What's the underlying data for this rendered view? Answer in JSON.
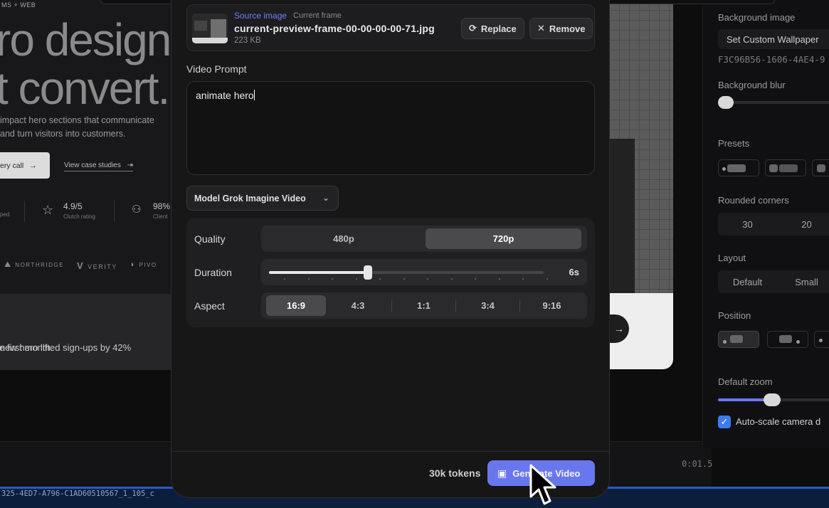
{
  "background_site": {
    "eyebrow": "MS + WEB",
    "hero_line1": "ro designs",
    "hero_line2": "t convert.",
    "sub_line1": "impact hero sections that communicate",
    "sub_line2": "and turn visitors into customers.",
    "cta_label": "ery call",
    "cta_arrow": "→",
    "case_link": "View case studies",
    "case_arrow": "⇥",
    "stat1_value": "4.9/5",
    "stat1_label": "Clutch rating",
    "stat2_value": "98%",
    "stat2_label": "Client",
    "stat0_label": "ped",
    "logos": [
      "NORTHRIDGE",
      "VERITY",
      "PIVO"
    ],
    "quote_line1": "r new hero lifted sign-ups by 42%",
    "quote_line2": "he first month."
  },
  "mid_preview": {
    "arrow": "→"
  },
  "timeline": {
    "timecode": "0:01.5"
  },
  "status_bar": {
    "text": "325-4ED7-A796-C1AD60510567_1_105_c"
  },
  "right_panel": {
    "background_image_label": "Background image",
    "wallpaper_button": "Set Custom Wallpaper",
    "uuid": "F3C96B56-1606-4AE4-9",
    "blur_label": "Background blur",
    "blur_value": 0,
    "presets_label": "Presets",
    "rounded_label": "Rounded corners",
    "rounded_options": [
      "30",
      "20"
    ],
    "layout_label": "Layout",
    "layout_options": [
      "Default",
      "Small"
    ],
    "position_label": "Position",
    "zoom_label": "Default zoom",
    "zoom_value": 0.6,
    "autoscale_label": "Auto-scale camera d",
    "autoscale_checked": true
  },
  "modal": {
    "source": {
      "label": "Source image",
      "sublabel": "Current frame",
      "filename": "current-preview-frame-00-00-00-00-71.jpg",
      "size": "223 KB",
      "replace_label": "Replace",
      "remove_label": "Remove"
    },
    "prompt_label": "Video Prompt",
    "prompt_value": "animate hero",
    "model_label": "Model Grok Imagine Video",
    "quality_label": "Quality",
    "quality_options": [
      "480p",
      "720p"
    ],
    "quality_selected": "720p",
    "duration_label": "Duration",
    "duration_value": "6s",
    "duration_fraction": 0.36,
    "aspect_label": "Aspect",
    "aspect_options": [
      "16:9",
      "4:3",
      "1:1",
      "3:4",
      "9:16"
    ],
    "aspect_selected": "16:9",
    "tokens": "30k tokens",
    "generate_label": "Generate Video"
  },
  "colors": {
    "accent": "#6977ee",
    "source_label": "#6e83ff",
    "checkbox": "#3d7bf0"
  }
}
